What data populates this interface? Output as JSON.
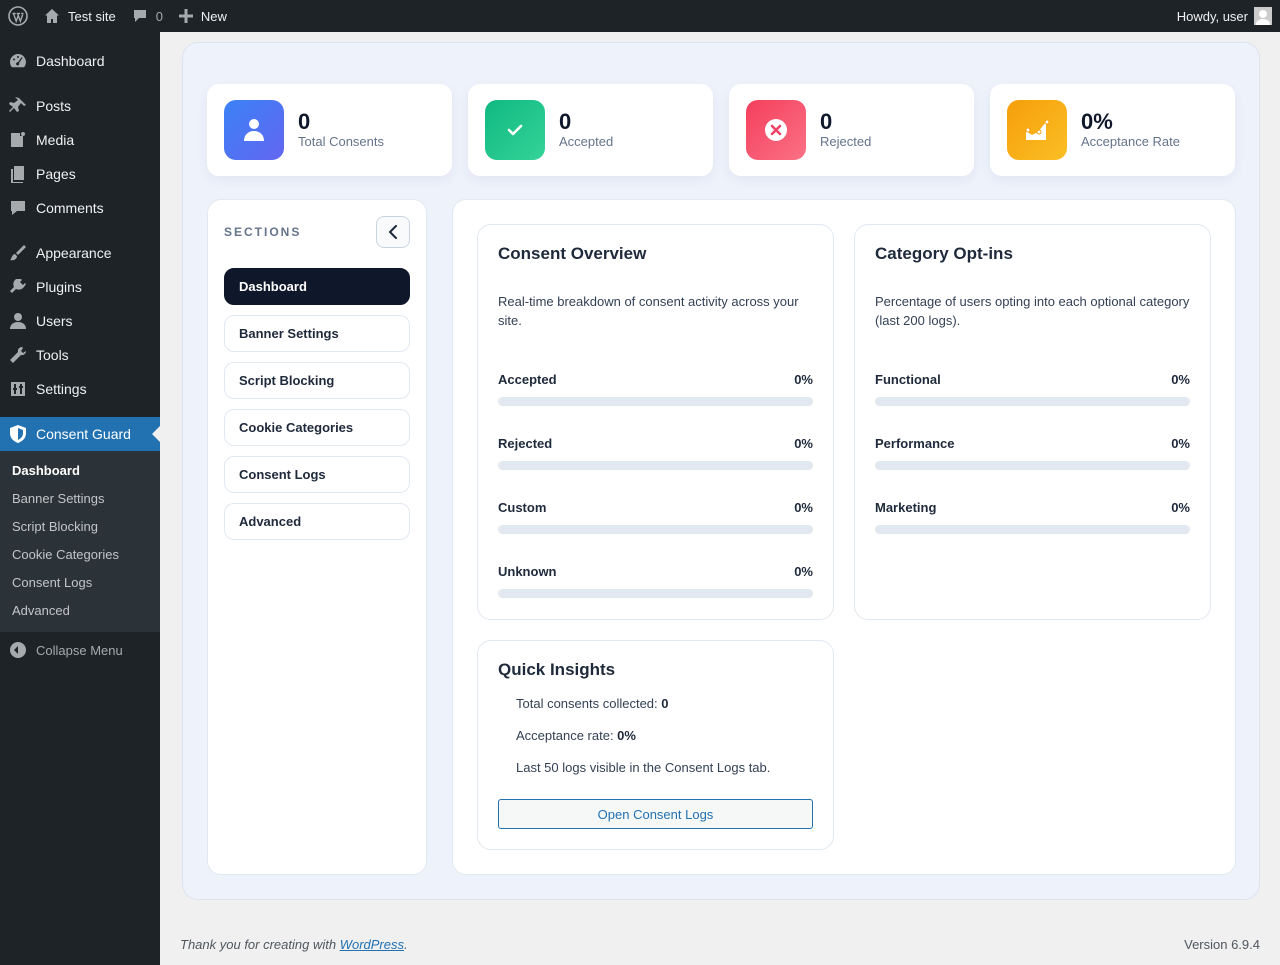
{
  "adminbar": {
    "site_name": "Test site",
    "comments_count": "0",
    "new_label": "New",
    "howdy": "Howdy, user"
  },
  "menu": {
    "items": [
      {
        "label": "Dashboard",
        "icon": "dashboard-icon"
      },
      {
        "label": "Posts",
        "icon": "pin-icon"
      },
      {
        "label": "Media",
        "icon": "media-icon"
      },
      {
        "label": "Pages",
        "icon": "pages-icon"
      },
      {
        "label": "Comments",
        "icon": "comment-icon"
      },
      {
        "label": "Appearance",
        "icon": "brush-icon"
      },
      {
        "label": "Plugins",
        "icon": "plug-icon"
      },
      {
        "label": "Users",
        "icon": "user-icon"
      },
      {
        "label": "Tools",
        "icon": "wrench-icon"
      },
      {
        "label": "Settings",
        "icon": "sliders-icon"
      }
    ],
    "current": {
      "label": "Consent Guard",
      "icon": "shield-icon"
    },
    "submenu": [
      "Dashboard",
      "Banner Settings",
      "Script Blocking",
      "Cookie Categories",
      "Consent Logs",
      "Advanced"
    ],
    "collapse": "Collapse Menu"
  },
  "stats": [
    {
      "value": "0",
      "label": "Total Consents",
      "icon": "user-icon",
      "color": "#4f6ef7"
    },
    {
      "value": "0",
      "label": "Accepted",
      "icon": "check-icon",
      "color": "#10b981"
    },
    {
      "value": "0",
      "label": "Rejected",
      "icon": "x-circle-icon",
      "color": "#f0456a"
    },
    {
      "value": "0%",
      "label": "Acceptance Rate",
      "icon": "chart-icon",
      "color": "#f59e0b"
    }
  ],
  "sections": {
    "title": "SECTIONS",
    "items": [
      "Dashboard",
      "Banner Settings",
      "Script Blocking",
      "Cookie Categories",
      "Consent Logs",
      "Advanced"
    ]
  },
  "overview": {
    "title": "Consent Overview",
    "desc": "Real-time breakdown of consent activity across your site.",
    "bars": [
      {
        "label": "Accepted",
        "value": "0%",
        "fraction": 0
      },
      {
        "label": "Rejected",
        "value": "0%",
        "fraction": 0
      },
      {
        "label": "Custom",
        "value": "0%",
        "fraction": 0
      },
      {
        "label": "Unknown",
        "value": "0%",
        "fraction": 0
      }
    ]
  },
  "optins": {
    "title": "Category Opt-ins",
    "desc": "Percentage of users opting into each optional category (last 200 logs).",
    "bars": [
      {
        "label": "Functional",
        "value": "0%",
        "fraction": 0
      },
      {
        "label": "Performance",
        "value": "0%",
        "fraction": 0
      },
      {
        "label": "Marketing",
        "value": "0%",
        "fraction": 0
      }
    ]
  },
  "insights": {
    "title": "Quick Insights",
    "total_label": "Total consents collected: ",
    "total_value": "0",
    "rate_label": "Acceptance rate: ",
    "rate_value": "0%",
    "logs_note": "Last 50 logs visible in the Consent Logs tab.",
    "button": "Open Consent Logs"
  },
  "footer": {
    "thanks_prefix": "Thank you for creating with ",
    "link": "WordPress",
    "suffix": ".",
    "version": "Version 6.9.4"
  },
  "colors": {
    "accent": "#2271b1",
    "admin_dark": "#1d2327"
  }
}
